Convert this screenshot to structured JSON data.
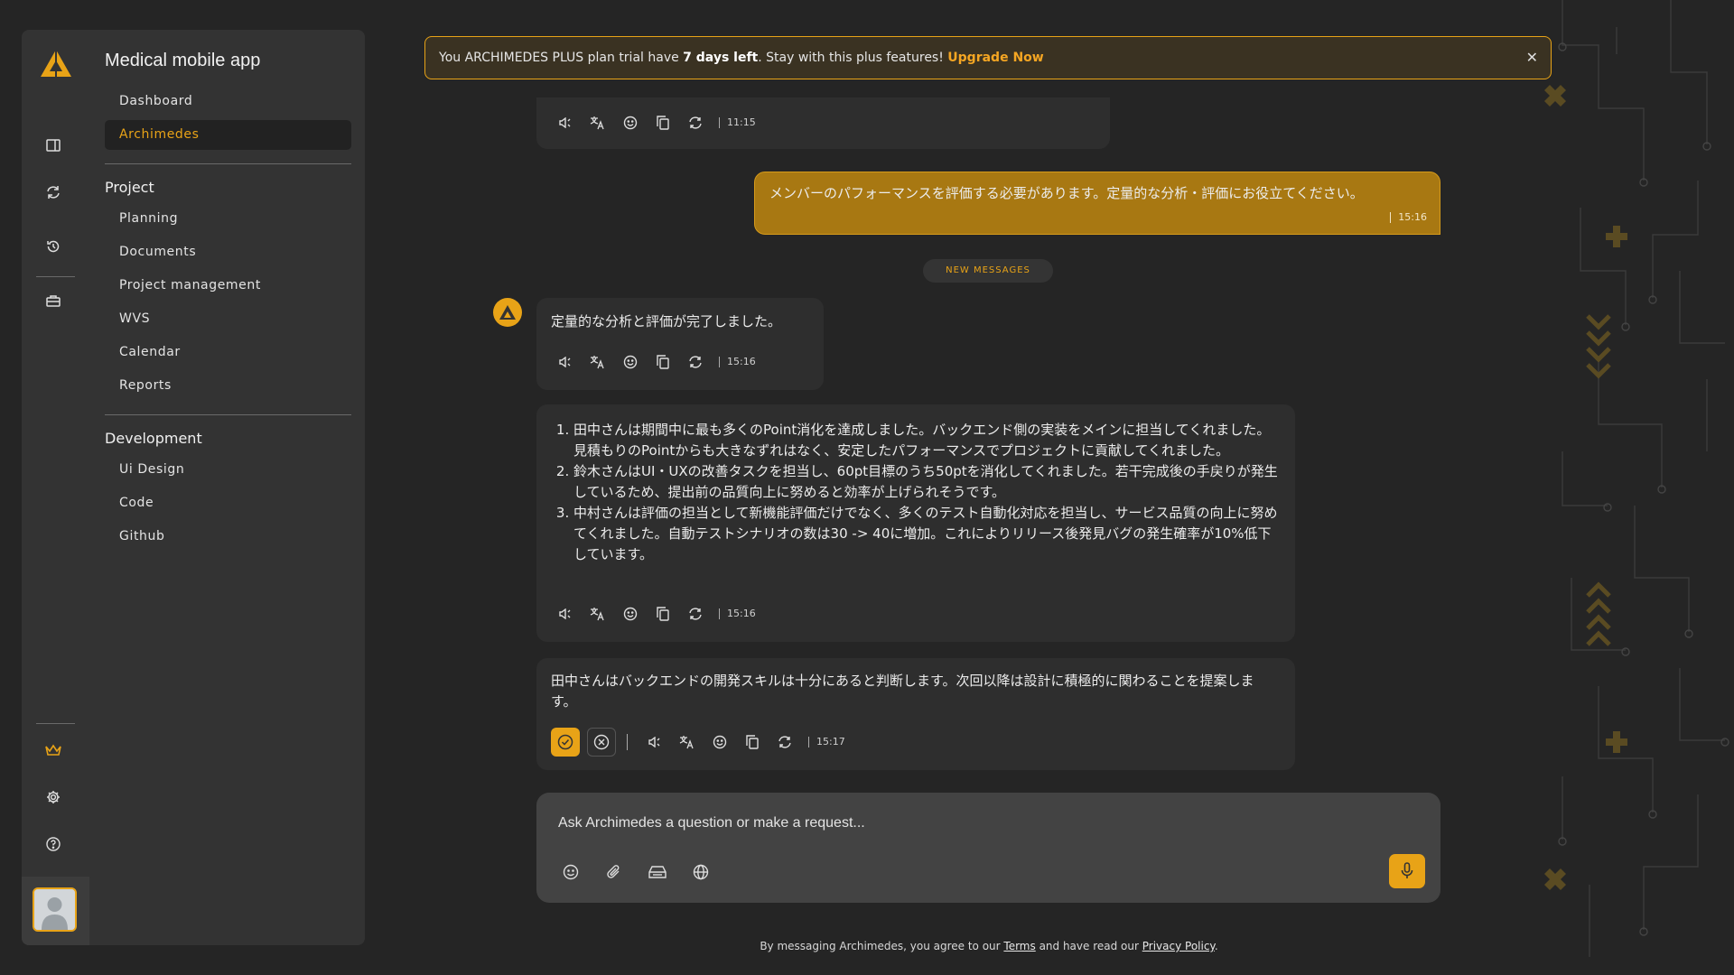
{
  "sidebar": {
    "project_title": "Medical mobile app",
    "top_items": [
      {
        "label": "Dashboard"
      },
      {
        "label": "Archimedes"
      }
    ],
    "sections": [
      {
        "title": "Project",
        "items": [
          {
            "label": "Planning"
          },
          {
            "label": "Documents"
          },
          {
            "label": "Project management"
          },
          {
            "label": "WVS"
          },
          {
            "label": "Calendar"
          },
          {
            "label": "Reports"
          }
        ]
      },
      {
        "title": "Development",
        "items": [
          {
            "label": "Ui Design"
          },
          {
            "label": "Code"
          },
          {
            "label": "Github"
          }
        ]
      }
    ]
  },
  "banner": {
    "prefix": "You ARCHIMEDES PLUS plan trial have ",
    "days": "7 days left",
    "suffix": ". Stay with this plus features! ",
    "cta": "Upgrade Now",
    "close": "✕"
  },
  "chat": {
    "first_time": "11:15",
    "user_message": {
      "text": "メンバーのパフォーマンスを評価する必要があります。定量的な分析・評価にお役立てください。",
      "time": "15:16"
    },
    "new_messages": "NEW MESSAGES",
    "bot_message_1": {
      "text": "定量的な分析と評価が完了しました。",
      "time": "15:16"
    },
    "bot_list": {
      "items": [
        "田中さんは期間中に最も多くのPoint消化を達成しました。バックエンド側の実装をメインに担当してくれました。見積もりのPointからも大きなずれはなく、安定したパフォーマンスでプロジェクトに貢献してくれました。",
        "鈴木さんはUI・UXの改善タスクを担当し、60pt目標のうち50ptを消化してくれました。若干完成後の手戻りが発生しているため、提出前の品質向上に努めると効率が上げられそうです。",
        "中村さんは評価の担当として新機能評価だけでなく、多くのテスト自動化対応を担当し、サービス品質の向上に努めてくれました。自動テストシナリオの数は30 -> 40に増加。これによりリリース後発見バグの発生確率が10%低下しています。"
      ],
      "time": "15:16"
    },
    "bot_message_3": {
      "text": "田中さんはバックエンドの開発スキルは十分にあると判断します。次回以降は設計に積極的に関わることを提案します。",
      "time": "15:17"
    }
  },
  "composer": {
    "placeholder": "Ask Archimedes a question or make a request..."
  },
  "footer": {
    "prefix": "By messaging Archimedes, you agree to our ",
    "terms": "Terms",
    "middle": " and have read our ",
    "privacy": "Privacy Policy",
    "suffix": "."
  },
  "colors": {
    "accent": "#e8a317",
    "background": "#252525",
    "panel": "#333333"
  }
}
